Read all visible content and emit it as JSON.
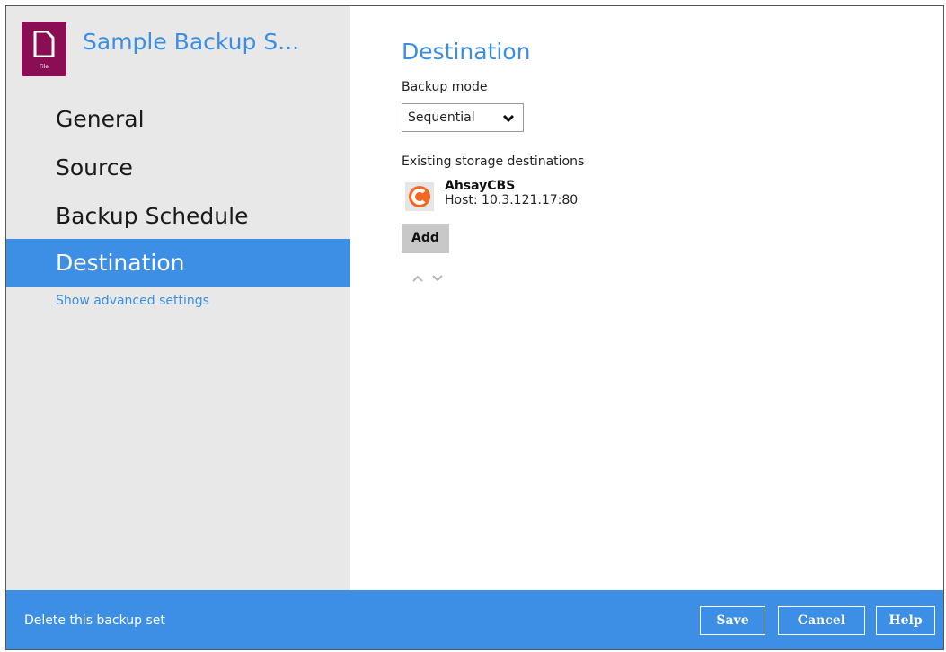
{
  "header": {
    "title": "Sample Backup S...",
    "file_icon_caption": "File",
    "file_icon_name": "file-icon"
  },
  "sidebar": {
    "items": [
      {
        "label": "General",
        "active": false
      },
      {
        "label": "Source",
        "active": false
      },
      {
        "label": "Backup Schedule",
        "active": false
      },
      {
        "label": "Destination",
        "active": true
      }
    ],
    "advanced_link": "Show advanced settings"
  },
  "main": {
    "title": "Destination",
    "backup_mode_label": "Backup mode",
    "backup_mode_value": "Sequential",
    "existing_label": "Existing storage destinations",
    "destinations": [
      {
        "name": "AhsayCBS",
        "host": "Host: 10.3.121.17:80",
        "icon": "ahsay-logo-icon"
      }
    ],
    "add_label": "Add"
  },
  "footer": {
    "delete_label": "Delete this backup set",
    "save_label": "Save",
    "cancel_label": "Cancel",
    "help_label": "Help"
  },
  "colors": {
    "accent": "#3d8fe6",
    "sidebar_bg": "#e8e8e8",
    "file_icon_bg": "#8b0e55",
    "ahsay_orange": "#f26722"
  }
}
